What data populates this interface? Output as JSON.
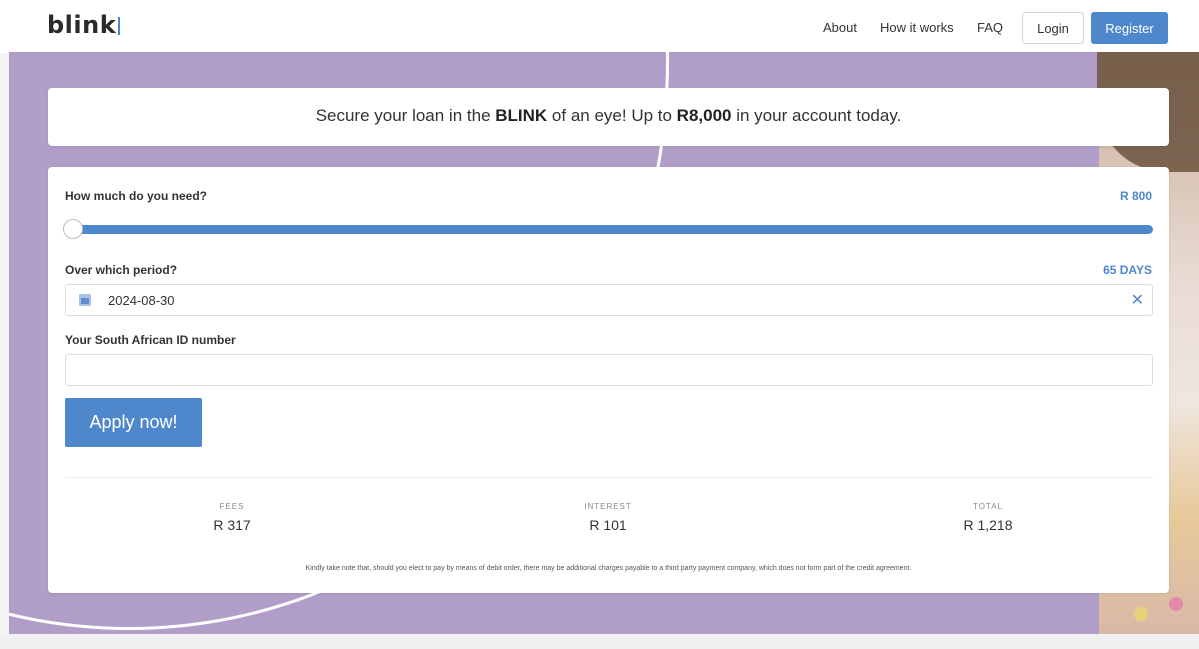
{
  "brand": {
    "logo_text": "blink"
  },
  "nav": {
    "about": "About",
    "how_it_works": "How it works",
    "faq": "FAQ",
    "login": "Login",
    "register": "Register"
  },
  "headline": {
    "part1": "Secure your loan in the ",
    "bold1": "BLINK",
    "part2": " of an eye! Up to ",
    "bold2": "R8,000",
    "part3": " in your account today."
  },
  "form": {
    "amount_label": "How much do you need?",
    "amount_value": "R 800",
    "amount_slider_fraction": 0.0,
    "period_label": "Over which period?",
    "period_value": "65 DAYS",
    "date_value": "2024-08-30",
    "clear_icon": "close-icon",
    "calendar_icon": "calendar-icon",
    "id_label": "Your South African ID number",
    "id_value": "",
    "apply_label": "Apply now!"
  },
  "summary": {
    "fees_label": "FEES",
    "fees_value": "R 317",
    "interest_label": "INTEREST",
    "interest_value": "R 101",
    "total_label": "TOTAL",
    "total_value": "R 1,218"
  },
  "disclaimer": "Kindly take note that, should you elect to pay by means of debit order, there may be additional charges payable to a third party payment company, which does not form part of the credit agreement.",
  "colors": {
    "accent": "#4f87cc",
    "hero_background": "#b09ec9"
  }
}
